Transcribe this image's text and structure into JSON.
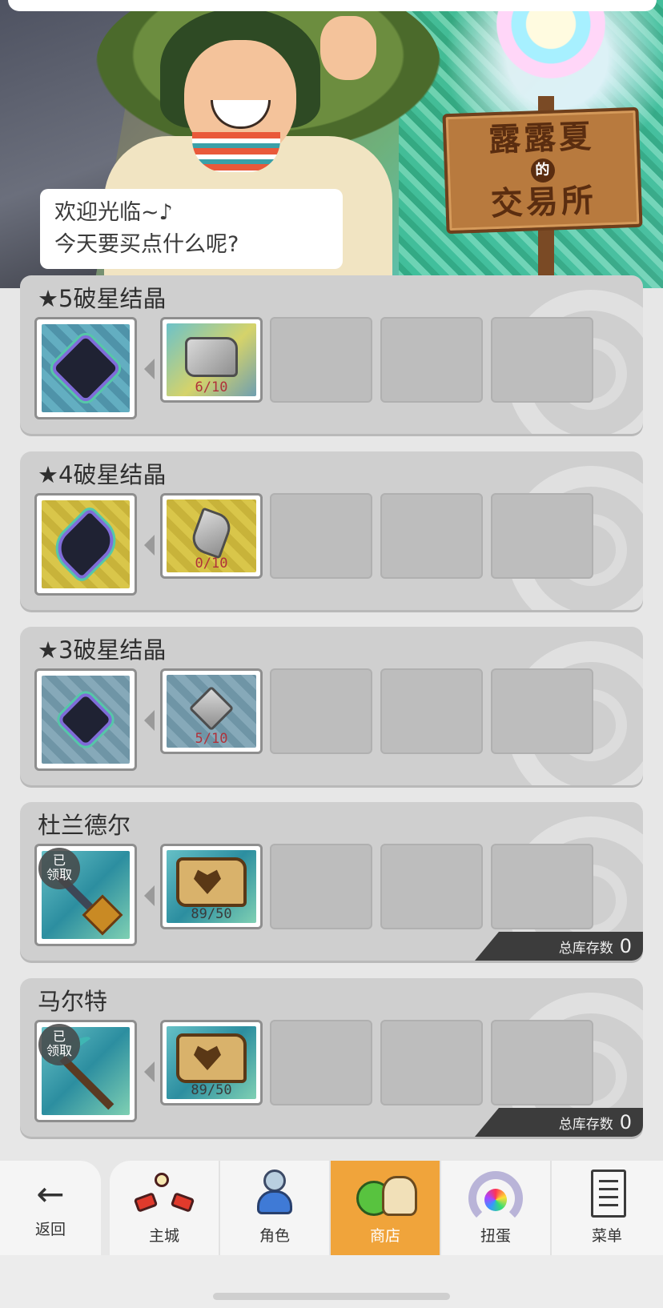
{
  "banner": {
    "sign_line1": "露露夏",
    "sign_line2": "的",
    "sign_line3": "交易所",
    "greeting_line1": "欢迎光临~♪",
    "greeting_line2": "今天要买点什么呢?"
  },
  "cards": [
    {
      "title": "★5破星结晶",
      "item_icon": "star5-crystal-icon",
      "material_icon": "ore-chunk-icon",
      "material_count": "6/10",
      "count_color": "#b0313a",
      "claimed": "",
      "stock_label": "",
      "stock_value": ""
    },
    {
      "title": "★4破星结晶",
      "item_icon": "star4-crystal-icon",
      "material_icon": "ore-shard-icon",
      "material_count": "0/10",
      "count_color": "#b0313a",
      "claimed": "",
      "stock_label": "",
      "stock_value": ""
    },
    {
      "title": "★3破星结晶",
      "item_icon": "star3-crystal-icon",
      "material_icon": "ore-gem-icon",
      "material_count": "5/10",
      "count_color": "#b0313a",
      "claimed": "",
      "stock_label": "",
      "stock_value": ""
    },
    {
      "title": "杜兰德尔",
      "item_icon": "spear-weapon-icon",
      "material_icon": "heart-scroll-icon",
      "material_count": "89/50",
      "count_color": "#3a3a3a",
      "claimed": "已\n领取",
      "stock_label": "总库存数",
      "stock_value": "0"
    },
    {
      "title": "马尔特",
      "item_icon": "pickaxe-weapon-icon",
      "material_icon": "heart-scroll-icon",
      "material_count": "89/50",
      "count_color": "#3a3a3a",
      "claimed": "已\n领取",
      "stock_label": "总库存数",
      "stock_value": "0"
    }
  ],
  "nav": {
    "back": "返回",
    "items": [
      {
        "label": "主城",
        "icon": "main-city-icon",
        "active": false
      },
      {
        "label": "角色",
        "icon": "character-icon",
        "active": false
      },
      {
        "label": "商店",
        "icon": "shop-icon",
        "active": true
      },
      {
        "label": "扭蛋",
        "icon": "gacha-icon",
        "active": false
      },
      {
        "label": "菜单",
        "icon": "menu-icon",
        "active": false
      }
    ]
  }
}
